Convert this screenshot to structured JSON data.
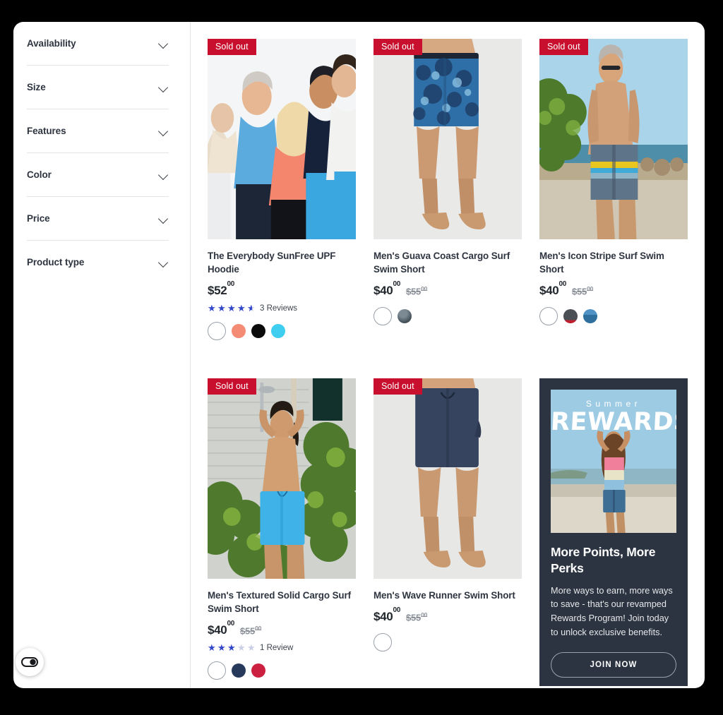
{
  "sidebar": {
    "filters": [
      {
        "label": "Availability",
        "icon": "chevron-down-icon"
      },
      {
        "label": "Size",
        "icon": "chevron-down-icon"
      },
      {
        "label": "Features",
        "icon": "chevron-down-icon"
      },
      {
        "label": "Color",
        "icon": "chevron-down-icon"
      },
      {
        "label": "Price",
        "icon": "chevron-down-icon"
      },
      {
        "label": "Product type",
        "icon": "chevron-down-icon"
      }
    ]
  },
  "products": [
    {
      "badge": "Sold out",
      "title": "The Everybody SunFree UPF Hoodie",
      "price": "$52",
      "price_cents": "00",
      "compare_price": "",
      "compare_cents": "",
      "rating": 4.5,
      "reviews_text": "3 Reviews",
      "swatches": [
        {
          "name": "light-blue",
          "color": "#67c3e8",
          "selected": true
        },
        {
          "name": "coral",
          "color": "#f48b74",
          "selected": false
        },
        {
          "name": "black",
          "color": "#0b0b0c",
          "selected": false
        },
        {
          "name": "cyan",
          "color": "#3fcdf0",
          "selected": false
        }
      ]
    },
    {
      "badge": "Sold out",
      "title": "Men's Guava Coast Cargo Surf Swim Short",
      "price": "$40",
      "price_cents": "00",
      "compare_price": "$55",
      "compare_cents": "00",
      "rating": 0,
      "reviews_text": "",
      "swatches": [
        {
          "name": "blue-floral",
          "color": "#1f6fa8",
          "selected": true
        },
        {
          "name": "gray-floral",
          "color": "#5c6b73",
          "selected": false
        }
      ]
    },
    {
      "badge": "Sold out",
      "title": "Men's Icon Stripe Surf Swim Short",
      "price": "$40",
      "price_cents": "00",
      "compare_price": "$55",
      "compare_cents": "00",
      "rating": 0,
      "reviews_text": "",
      "swatches": [
        {
          "name": "gray-yellow-stripe",
          "color": "#e8c92a",
          "selected": true
        },
        {
          "name": "charcoal-red-stripe",
          "color": "#33373c",
          "selected": false
        },
        {
          "name": "blue-stripe",
          "color": "#3b7bab",
          "selected": false
        }
      ]
    },
    {
      "badge": "Sold out",
      "title": "Men's Textured Solid Cargo Surf Swim Short",
      "price": "$40",
      "price_cents": "00",
      "compare_price": "$55",
      "compare_cents": "00",
      "rating": 3,
      "reviews_text": "1 Review",
      "swatches": [
        {
          "name": "cyan",
          "color": "#3cc6ec",
          "selected": true
        },
        {
          "name": "navy",
          "color": "#273a5c",
          "selected": false
        },
        {
          "name": "red",
          "color": "#cb203f",
          "selected": false
        }
      ]
    },
    {
      "badge": "Sold out",
      "title": "Men's Wave Runner Swim Short",
      "price": "$40",
      "price_cents": "00",
      "compare_price": "$55",
      "compare_cents": "00",
      "rating": 0,
      "reviews_text": "",
      "swatches": [
        {
          "name": "navy",
          "color": "#27395c",
          "selected": true
        }
      ]
    }
  ],
  "promo": {
    "eyebrow": "Summer",
    "wordmark": "REWARDS",
    "heading": "More Points, More Perks",
    "body": "More ways to earn, more ways to save - that's our revamped Rewards Program! Join today to unlock exclusive benefits.",
    "cta": "JOIN NOW",
    "background_color": "#2b3440"
  },
  "accessibility_widget": {
    "icon": "accessibility-toggle-icon"
  },
  "colors": {
    "badge_red": "#c8102e",
    "star_blue": "#3348c8",
    "text_dark": "#2e3540"
  }
}
